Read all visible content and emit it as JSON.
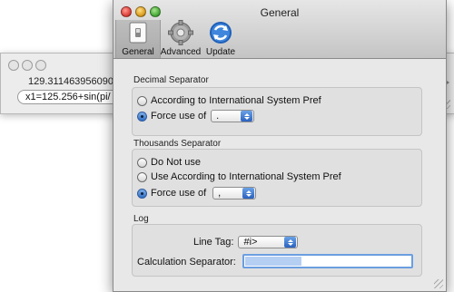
{
  "background_window": {
    "result": "129.3114639560909",
    "expression": "x1=125.256+sin(pi/"
  },
  "prefs": {
    "title": "General",
    "toolbar": [
      {
        "label": "General",
        "icon": "switch-icon"
      },
      {
        "label": "Advanced",
        "icon": "gear-icon"
      },
      {
        "label": "Update",
        "icon": "sync-icon"
      }
    ],
    "decimal": {
      "label": "Decimal Separator",
      "option1": "According to International System Pref",
      "option2": "Force use of",
      "value": "."
    },
    "thousands": {
      "label": "Thousands Separator",
      "option1": "Do Not use",
      "option2": "Use According to International System Pref",
      "option3": "Force use of",
      "value": ","
    },
    "log": {
      "label": "Log",
      "line_tag_label": "Line Tag:",
      "line_tag_value": "#i>",
      "calc_sep_label": "Calculation Separator:"
    }
  },
  "colors": {
    "close": "#e0443e",
    "minimize": "#dea123",
    "zoom": "#4cae3b",
    "accent": "#2f6fc4"
  }
}
